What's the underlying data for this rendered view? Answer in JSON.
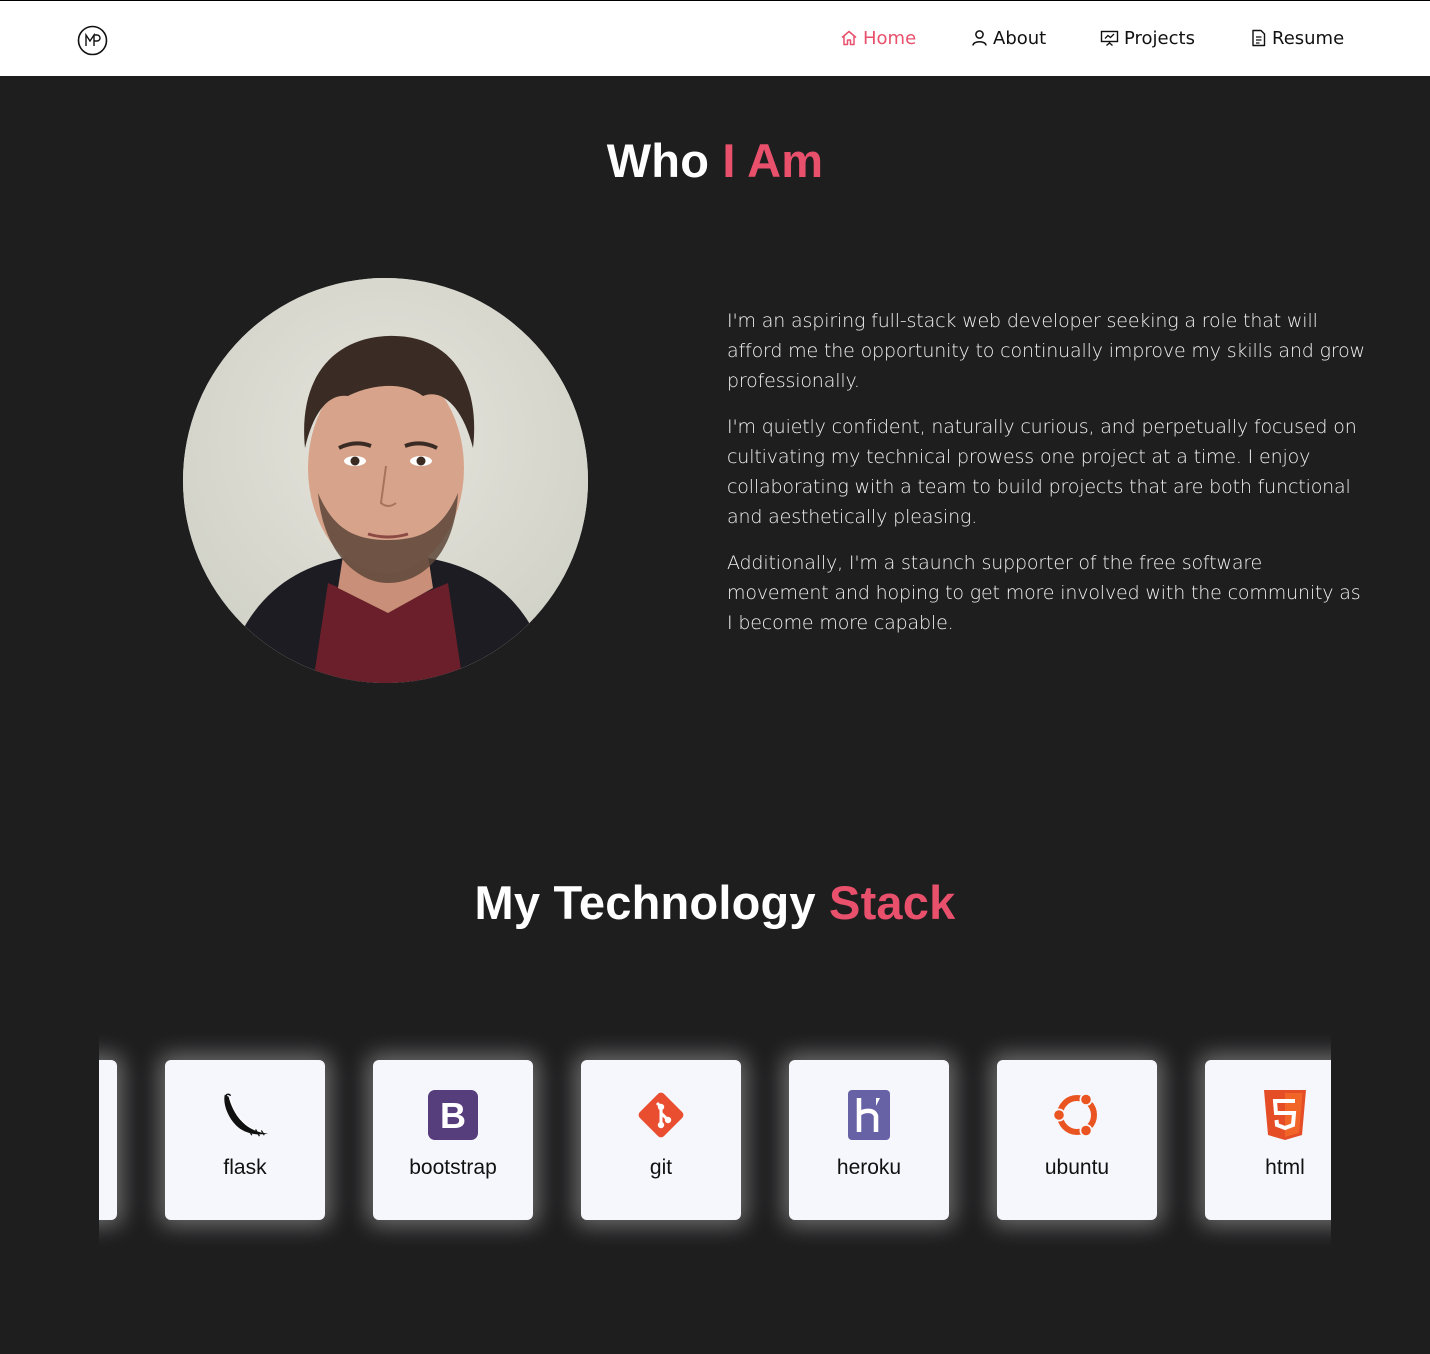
{
  "nav": {
    "logo": "MP",
    "items": [
      {
        "label": "Home",
        "icon": "home-icon",
        "active": true
      },
      {
        "label": "About",
        "icon": "user-icon",
        "active": false
      },
      {
        "label": "Projects",
        "icon": "presentation-icon",
        "active": false
      },
      {
        "label": "Resume",
        "icon": "document-icon",
        "active": false
      }
    ]
  },
  "about": {
    "title_main": "Who",
    "title_accent": "I Am",
    "paragraphs": [
      "I'm an aspiring full-stack web developer seeking a role that will afford me the opportunity to continually improve my skills and grow professionally.",
      "I'm quietly confident, naturally curious, and perpetually focused on cultivating my technical prowess one project at a time. I enjoy collaborating with a team to build projects that are both functional and aesthetically pleasing.",
      "Additionally, I'm a staunch supporter of the free software movement and hoping to get more involved with the community as I become more capable."
    ]
  },
  "stack": {
    "title_main": "My Technology",
    "title_accent": "Stack",
    "cards": [
      {
        "label": "flask",
        "icon": "flask-icon"
      },
      {
        "label": "bootstrap",
        "icon": "bootstrap-icon"
      },
      {
        "label": "git",
        "icon": "git-icon"
      },
      {
        "label": "heroku",
        "icon": "heroku-icon"
      },
      {
        "label": "ubuntu",
        "icon": "ubuntu-icon"
      },
      {
        "label": "html",
        "icon": "html5-icon"
      }
    ]
  },
  "colors": {
    "accent": "#e8506c",
    "background": "#1e1e1f",
    "card": "#f6f7fc",
    "bootstrap": "#563d7c",
    "git": "#e94e31",
    "heroku": "#6762a6",
    "ubuntu": "#e95420",
    "html": "#e44d26"
  }
}
